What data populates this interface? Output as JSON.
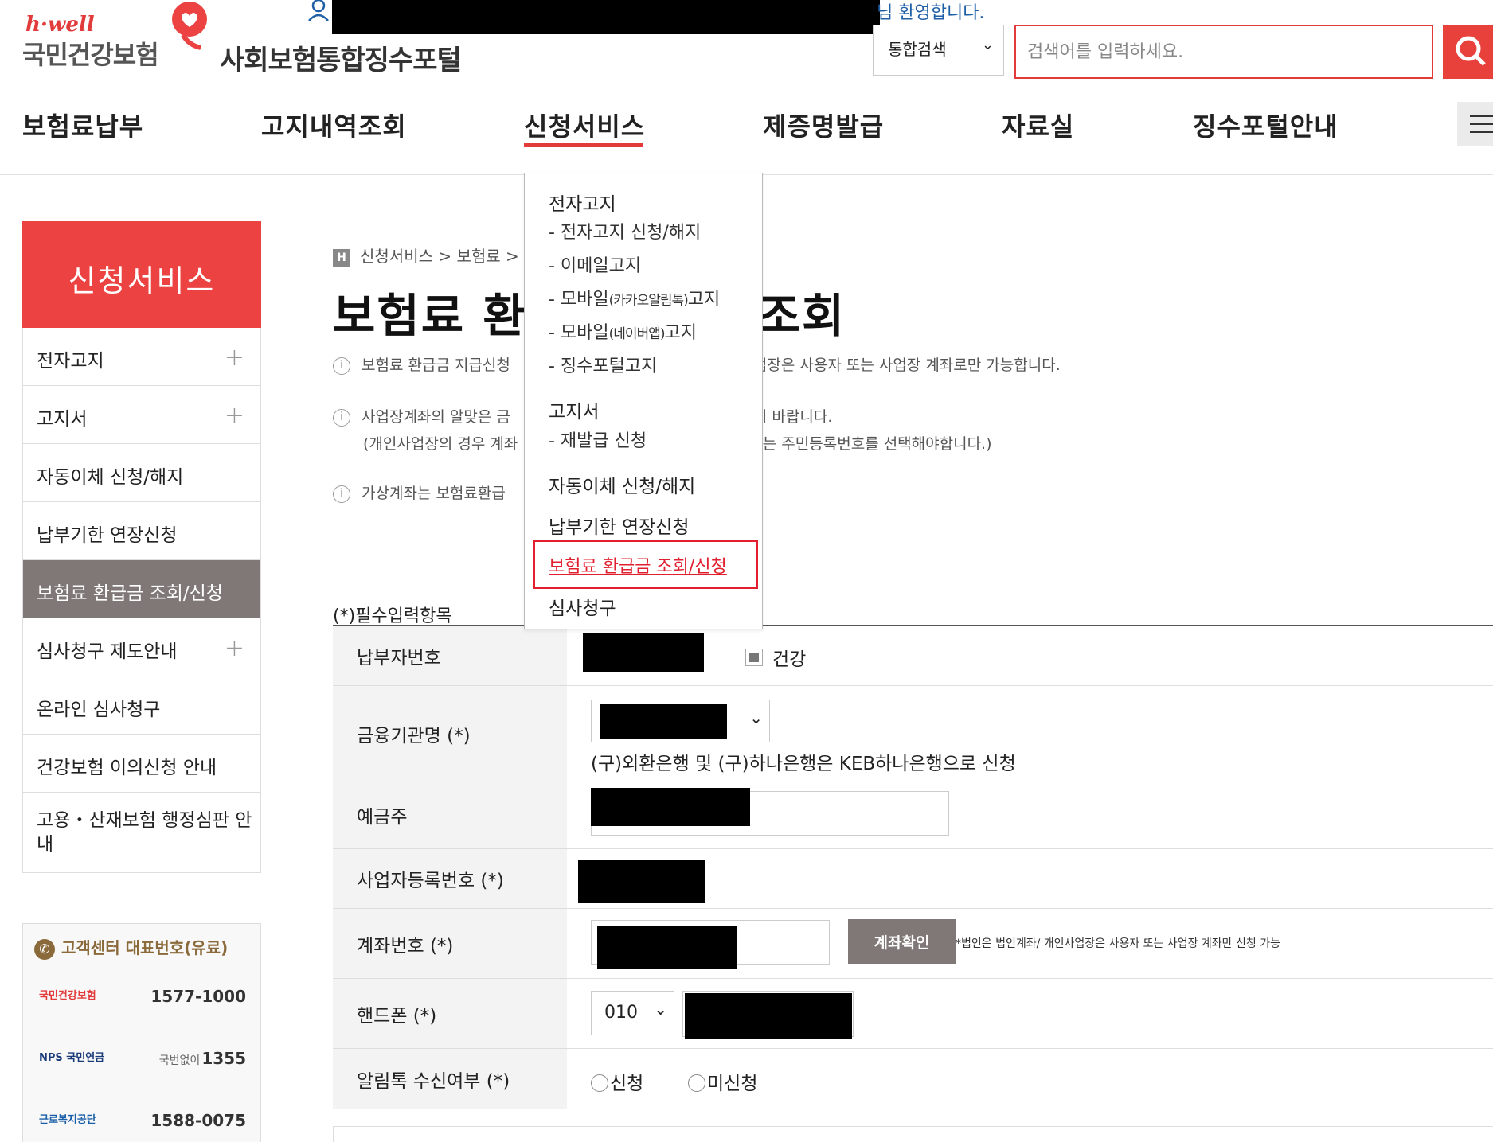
{
  "header": {
    "logo_hwell": "h·well",
    "logo_org": "국민건강보험",
    "portal_name": "사회보험통합징수포털",
    "welcome_suffix": "님 환영합니다.",
    "search_scope": "통합검색",
    "search_placeholder": "검색어를 입력하세요."
  },
  "nav": {
    "items": [
      "보험료납부",
      "고지내역조회",
      "신청서비스",
      "제증명발급",
      "자료실",
      "징수포털안내"
    ],
    "active": "신청서비스"
  },
  "dropdown": {
    "group1_title": "전자고지",
    "group1_items": [
      "- 전자고지 신청/해지",
      "- 이메일고지",
      "- 모바일",
      "(카카오알림톡)",
      "고지",
      "- 모바일",
      "(네이버앱)",
      "고지",
      "- 징수포털고지"
    ],
    "group2_title": "고지서",
    "group2_items": [
      "- 재발급 신청"
    ],
    "item3": "자동이체 신청/해지",
    "item4": "납부기한 연장신청",
    "item5": "보험료 환급금 조회/신청",
    "item6": "심사청구"
  },
  "sidebar": {
    "title": "신청서비스",
    "items": [
      {
        "label": "전자고지",
        "expandable": "+"
      },
      {
        "label": "고지서",
        "expandable": "+"
      },
      {
        "label": "자동이체 신청/해지"
      },
      {
        "label": "납부기한 연장신청"
      },
      {
        "label": "보험료 환급금 조회/신청"
      },
      {
        "label": "심사청구 제도안내",
        "expandable": "+"
      },
      {
        "label": "온라인 심사청구"
      },
      {
        "label": "건강보험 이의신청 안내"
      },
      {
        "label": "고용・산재보험 행정심판 안내"
      }
    ],
    "active_index": 4,
    "customer_center": {
      "title": "고객센터 대표번호(유료)",
      "rows": [
        {
          "org": "국민건강보험",
          "number": "1577-1000"
        },
        {
          "org": "NPS 국민연금",
          "prefix": "국번없이",
          "number": "1355"
        },
        {
          "org": "근로복지공단",
          "number": "1588-0075"
        }
      ]
    }
  },
  "content": {
    "breadcrumb_home": "H",
    "breadcrumb": "신청서비스 >   보험료 >",
    "title_left": "보험료 환",
    "title_right": "조회",
    "notice1_left": "보험료 환급금 지급신청",
    "notice1_right": "업장은 사용자 또는 사업장 계좌로만 가능합니다.",
    "notice2_left": "사업장계좌의 알맞은 금",
    "notice2_right": "기 바랍니다.",
    "notice2b_left": "(개인사업장의 경우 계좌",
    "notice2b_right": "또는 주민등록번호를 선택해야합니다.)",
    "notice3_left": "가상계좌는 보험료환급"
  },
  "form": {
    "required_label": "(*)필수입력항목",
    "rows": {
      "payer_no": "납부자번호",
      "payer_type": "건강",
      "bank": "금융기관명 (*)",
      "bank_note": "(구)외환은행 및 (구)하나은행은 KEB하나은행으로 신청",
      "depositor": "예금주",
      "biz_no": "사업자등록번호 (*)",
      "account": "계좌번호 (*)",
      "verify_button": "계좌확인",
      "account_note": "*법인은 법인계좌/ 개인사업장은 사용자 또는 사업장 계좌만 신청 가능",
      "phone": "핸드폰 (*)",
      "phone_prefix": "010",
      "alimtalk": "알림톡 수신여부 (*)",
      "opt_yes": "신청",
      "opt_no": "미신청"
    }
  },
  "colors": {
    "brand_red": "#ec4242",
    "active_gray": "#7f7876",
    "highlight_red": "#e11f2e",
    "link_blue": "#1f5fa6"
  }
}
